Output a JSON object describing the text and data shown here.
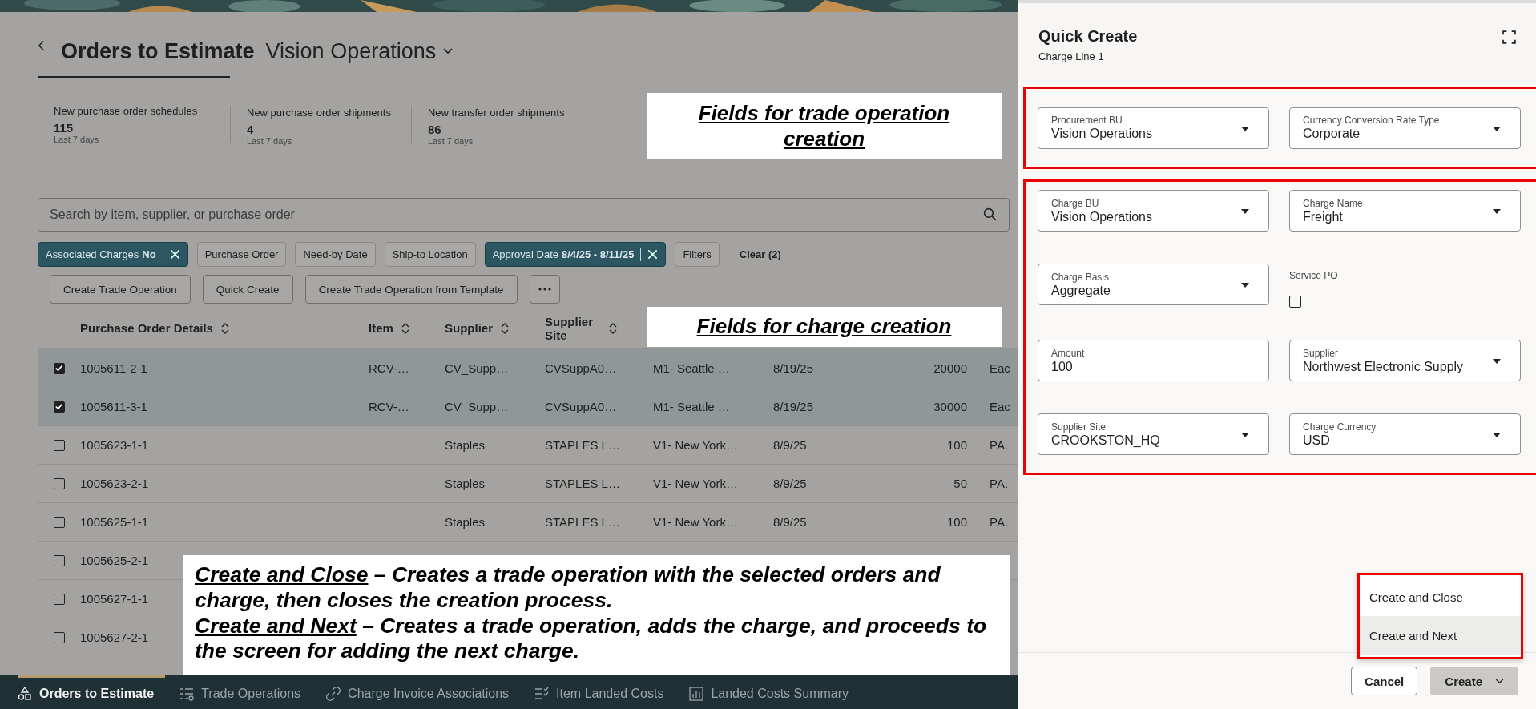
{
  "banner": {
    "kind": "picture"
  },
  "page": {
    "title": "Orders to Estimate",
    "context": "Vision Operations"
  },
  "metrics": [
    {
      "label": "New purchase order schedules",
      "value": "115",
      "period": "Last 7 days",
      "selected": true
    },
    {
      "label": "New purchase order shipments",
      "value": "4",
      "period": "Last 7 days",
      "selected": false
    },
    {
      "label": "New transfer order shipments",
      "value": "86",
      "period": "Last 7 days",
      "selected": false
    }
  ],
  "search": {
    "placeholder": "Search by item, supplier, or purchase order"
  },
  "filters": [
    {
      "label": "Associated Charges",
      "value": "No",
      "applied": true
    },
    {
      "label": "Purchase Order",
      "applied": false
    },
    {
      "label": "Need-by Date",
      "applied": false
    },
    {
      "label": "Ship-to Location",
      "applied": false
    },
    {
      "label": "Approval Date",
      "value": "8/4/25 - 8/11/25",
      "applied": true
    },
    {
      "label": "Filters",
      "applied": false
    }
  ],
  "clear": "Clear (2)",
  "actions": [
    "Create Trade Operation",
    "Quick Create",
    "Create Trade Operation from Template"
  ],
  "table": {
    "columns": [
      {
        "label": "Purchase Order Details",
        "sortable": true
      },
      {
        "label": "Item",
        "sortable": true
      },
      {
        "label": "Supplier",
        "sortable": true
      },
      {
        "label": "Supplier Site",
        "sortable": true
      }
    ],
    "rows": [
      {
        "selected": true,
        "po": "1005611-2-1",
        "item": "RCV-…",
        "supplier": "CV_Supp…",
        "site": "CVSuppA0…",
        "column_5": "M1- Seattle …",
        "column_6": "8/19/25",
        "column_7": "20000",
        "column_8": "Eac"
      },
      {
        "selected": true,
        "po": "1005611-3-1",
        "item": "RCV-…",
        "supplier": "CV_Supp…",
        "site": "CVSuppA0…",
        "column_5": "M1- Seattle …",
        "column_6": "8/19/25",
        "column_7": "30000",
        "column_8": "Eac"
      },
      {
        "selected": false,
        "po": "1005623-1-1",
        "supplier": "Staples",
        "site": "STAPLES L…",
        "column_5": "V1- New York…",
        "column_6": "8/9/25",
        "column_7": "100",
        "column_8": "PA."
      },
      {
        "selected": false,
        "po": "1005623-2-1",
        "supplier": "Staples",
        "site": "STAPLES L…",
        "column_5": "V1- New York…",
        "column_6": "8/9/25",
        "column_7": "50",
        "column_8": "PA."
      },
      {
        "selected": false,
        "po": "1005625-1-1",
        "supplier": "Staples",
        "site": "STAPLES L…",
        "column_5": "V1- New York…",
        "column_6": "8/9/25",
        "column_7": "100",
        "column_8": "PA."
      },
      {
        "selected": false,
        "po": "1005625-2-1"
      },
      {
        "selected": false,
        "po": "1005627-1-1"
      },
      {
        "selected": false,
        "po": "1005627-2-1"
      }
    ]
  },
  "nav": [
    {
      "label": "Orders to Estimate",
      "selected": true
    },
    {
      "label": "Trade Operations",
      "selected": false
    },
    {
      "label": "Charge Invoice Associations",
      "selected": false
    },
    {
      "label": "Item Landed Costs",
      "selected": false
    },
    {
      "label": "Landed Costs Summary",
      "selected": false
    }
  ],
  "annotations": [
    {
      "text": "Fields for trade operation creation"
    },
    {
      "text": "Fields for charge creation"
    }
  ],
  "note": [
    {
      "term": "Create and Close",
      "text": "– Creates a trade operation with the selected orders and charge, then closes the creation process."
    },
    {
      "term": "Create and Next",
      "text": "– Creates a trade operation, adds the charge, and proceeds to the screen for adding the next charge."
    }
  ],
  "panel": {
    "title": "Quick Create",
    "subtitle": "Charge Line 1",
    "sections": [
      {
        "fields": [
          {
            "kind": "select",
            "label": "Procurement BU",
            "value": "Vision Operations"
          },
          {
            "kind": "select",
            "label": "Currency Conversion Rate Type",
            "value": "Corporate"
          }
        ]
      },
      {
        "fields": [
          {
            "kind": "select",
            "label": "Charge BU",
            "value": "Vision Operations"
          },
          {
            "kind": "select",
            "label": "Charge Name",
            "value": "Freight"
          },
          {
            "kind": "select",
            "label": "Charge Basis",
            "value": "Aggregate"
          },
          {
            "kind": "checkbox",
            "label": "Service PO",
            "checked": false
          },
          {
            "kind": "text",
            "label": "Amount",
            "value": "100"
          },
          {
            "kind": "select",
            "label": "Supplier",
            "value": "Northwest Electronic Supply"
          },
          {
            "kind": "select",
            "label": "Supplier Site",
            "value": "CROOKSTON_HQ"
          },
          {
            "kind": "select",
            "label": "Charge Currency",
            "value": "USD"
          }
        ]
      }
    ],
    "menu": [
      {
        "label": "Create and Close",
        "selected": false
      },
      {
        "label": "Create and Next",
        "selected": true
      }
    ],
    "buttons": [
      {
        "kind": "secondary",
        "label": "Cancel"
      },
      {
        "kind": "split",
        "label": "Create"
      }
    ]
  }
}
